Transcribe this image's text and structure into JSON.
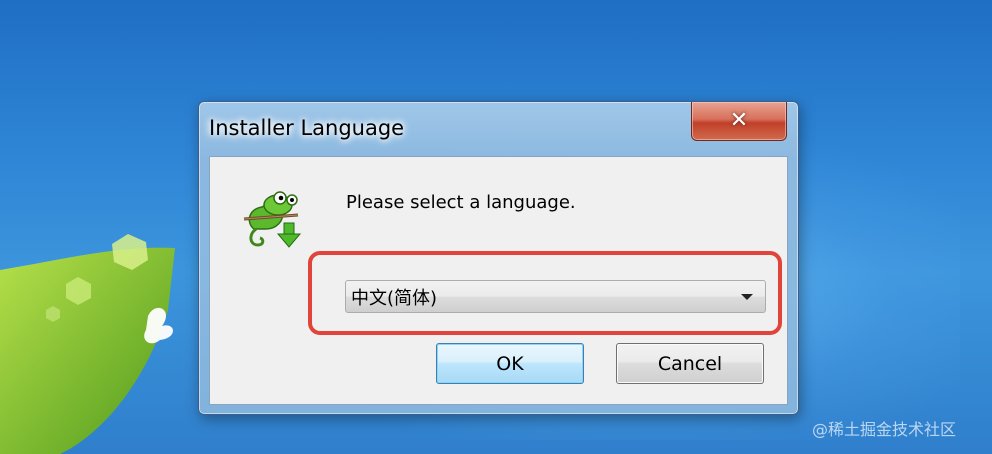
{
  "window": {
    "title": "Installer Language",
    "close_glyph": "✕"
  },
  "dialog": {
    "prompt": "Please select a language.",
    "icon": "notepad-plus-plus-chameleon-installer-icon",
    "language_select": {
      "selected": "中文(简体)"
    },
    "ok_label": "OK",
    "cancel_label": "Cancel"
  },
  "desktop": {
    "watermark": "@稀土掘金技术社区"
  },
  "colors": {
    "highlight_border": "#e0443a",
    "close_button": "#c0402a",
    "ok_button": "#bee6fd",
    "desktop_blue": "#2f86d6"
  }
}
